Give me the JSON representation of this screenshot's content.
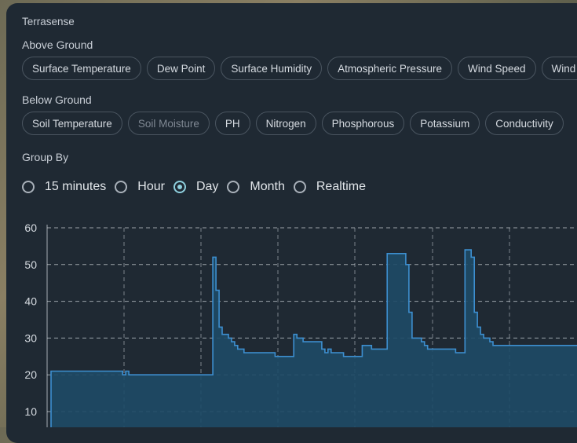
{
  "app_title": "Terrasense",
  "above_ground": {
    "label": "Above Ground",
    "chips": [
      "Surface Temperature",
      "Dew Point",
      "Surface Humidity",
      "Atmospheric Pressure",
      "Wind Speed",
      "Wind Direction"
    ]
  },
  "below_ground": {
    "label": "Below Ground",
    "chips": [
      "Soil Temperature",
      "Soil Moisture",
      "PH",
      "Nitrogen",
      "Phosphorous",
      "Potassium",
      "Conductivity"
    ]
  },
  "group_by": {
    "label": "Group By",
    "options": [
      "15 minutes",
      "Hour",
      "Day",
      "Month",
      "Realtime"
    ],
    "selected": "Day"
  },
  "colors": {
    "line": "#3d8fd0",
    "fill": "#1e4a66",
    "grid": "#c7cdd3",
    "selected_radio": "#8fd0de"
  },
  "chart_data": {
    "type": "area",
    "yticks": [
      10,
      20,
      30,
      40,
      50,
      60
    ],
    "ylim": [
      5,
      60
    ],
    "grid": true,
    "x": [
      0,
      1,
      2,
      23,
      24,
      25,
      26,
      27,
      28,
      52,
      53,
      54,
      55,
      56,
      57,
      58,
      59,
      60,
      61,
      63,
      68,
      72,
      73,
      74,
      75,
      76,
      77,
      78,
      79,
      80,
      81,
      82,
      88,
      89,
      90,
      91,
      95,
      97,
      100,
      101,
      104,
      105,
      108,
      109,
      110,
      115,
      116,
      117,
      120,
      121,
      122,
      125,
      130,
      131,
      132,
      133,
      134,
      135,
      136,
      137,
      138,
      139,
      140,
      142,
      143,
      146,
      150,
      151,
      152,
      154,
      155,
      156,
      157,
      158,
      159,
      160,
      161,
      162,
      163,
      164,
      165,
      166,
      167,
      168,
      169,
      170
    ],
    "values": [
      5,
      21,
      21,
      21,
      20,
      21,
      20,
      20,
      20,
      20,
      52,
      43,
      33,
      31,
      31,
      30,
      29,
      28,
      27,
      26,
      26,
      26,
      25,
      25,
      25,
      25,
      25,
      25,
      31,
      30,
      30,
      29,
      27,
      26,
      27,
      26,
      25,
      25,
      25,
      28,
      27,
      27,
      27,
      53,
      53,
      50,
      37,
      30,
      29,
      28,
      27,
      27,
      27,
      26,
      26,
      26,
      54,
      54,
      52,
      37,
      33,
      31,
      30,
      29,
      28,
      28,
      28,
      28,
      28,
      28,
      28,
      28,
      28,
      28,
      28,
      28,
      28,
      28,
      28,
      28,
      28,
      28,
      28,
      28,
      28,
      28
    ]
  }
}
